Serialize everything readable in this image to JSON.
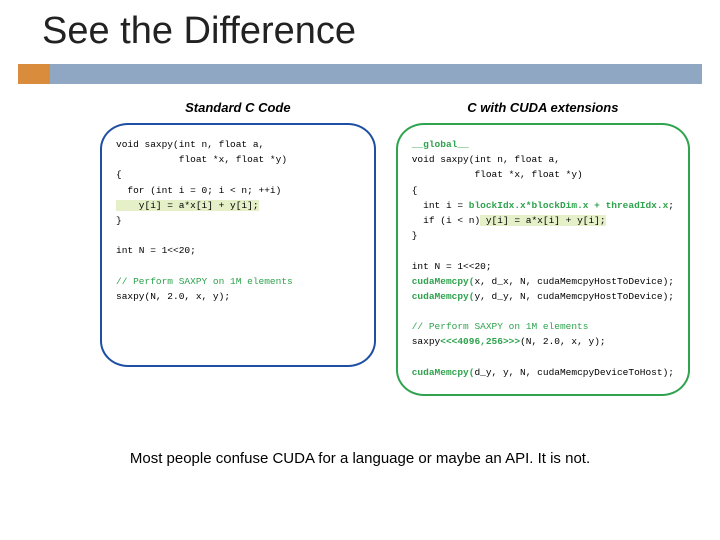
{
  "title": "See the Difference",
  "columns": {
    "left": {
      "header": "Standard C Code",
      "code": {
        "l1": "void saxpy(int n, float a,",
        "l2": "           float *x, float *y)",
        "l3": "{",
        "l4a": "  for (int i = 0; i < n; ++i)",
        "l5": "    y[i] = a*x[i] + y[i];",
        "l6": "}",
        "l7": "",
        "l8": "int N = 1<<20;",
        "l9": "",
        "l10": "// Perform SAXPY on 1M elements",
        "l11": "saxpy(N, 2.0, x, y);"
      }
    },
    "right": {
      "header": "C with CUDA extensions",
      "code": {
        "r1": "__global__",
        "r2": "void saxpy(int n, float a,",
        "r3": "           float *x, float *y)",
        "r4": "{",
        "r5a": "  int i = ",
        "r5b": "blockIdx.x*blockDim.x + threadIdx.x",
        "r5c": ";",
        "r6a": "  if (i < n)",
        "r6b": " y[i] = a*x[i] + y[i];",
        "r7": "}",
        "r8": "",
        "r9": "int N = 1<<20;",
        "r10a": "cudaMemcpy(",
        "r10b": "x, d_x, N, cudaMemcpyHostToDevice);",
        "r11a": "cudaMemcpy(",
        "r11b": "y, d_y, N, cudaMemcpyHostToDevice);",
        "r12": "",
        "r13": "// Perform SAXPY on 1M elements",
        "r14a": "saxpy",
        "r14b": "<<<4096,256>>>",
        "r14c": "(N, 2.0, x, y);",
        "r15": "",
        "r16a": "cudaMemcpy(",
        "r16b": "d_y, y, N, cudaMemcpyDeviceToHost);"
      }
    }
  },
  "footer": "Most people confuse CUDA for a language or maybe an API. It is not."
}
